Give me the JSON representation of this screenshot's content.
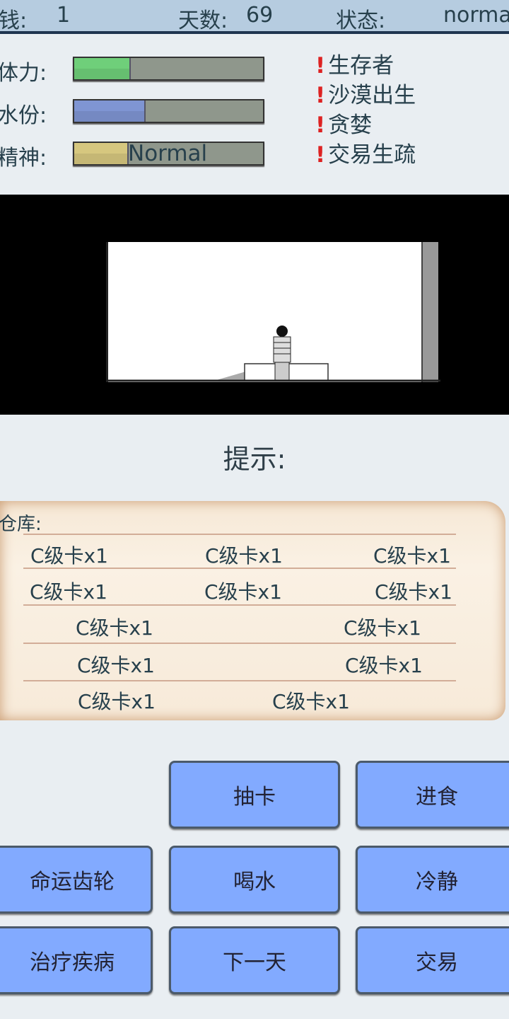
{
  "status": {
    "money_label": "钱:",
    "money": "1",
    "days_label": "天数:",
    "days": "69",
    "state_label": "状态:",
    "state": "normal"
  },
  "stats": [
    {
      "label": "体力:",
      "fill_percent": 30,
      "color": "#6fcf7a"
    },
    {
      "label": "水份:",
      "fill_percent": 38,
      "color": "#7f95d3"
    },
    {
      "label": "精神:",
      "fill_percent": 29,
      "color": "#d6c77f",
      "text": "Normal"
    }
  ],
  "traits": [
    "生存者",
    "沙漠出生",
    "贪婪",
    "交易生疏"
  ],
  "hint_label": "提示:",
  "warehouse": {
    "label": "仓库:",
    "rows": [
      [
        "C级卡x1",
        "C级卡x1",
        "C级卡x1"
      ],
      [
        "C级卡x1",
        "C级卡x1",
        "C级卡x1"
      ],
      [
        "C级卡x1",
        "C级卡x1"
      ],
      [
        "C级卡x1",
        "C级卡x1"
      ],
      [
        "C级卡x1",
        "C级卡x1"
      ]
    ]
  },
  "buttons": {
    "draw": "抽卡",
    "eat": "进食",
    "fate": "命运齿轮",
    "drink": "喝水",
    "calm": "冷静",
    "heal": "治疗疾病",
    "next_day": "下一天",
    "trade": "交易"
  },
  "colors": {
    "button": "#82aaff",
    "header": "#b6cce0"
  }
}
